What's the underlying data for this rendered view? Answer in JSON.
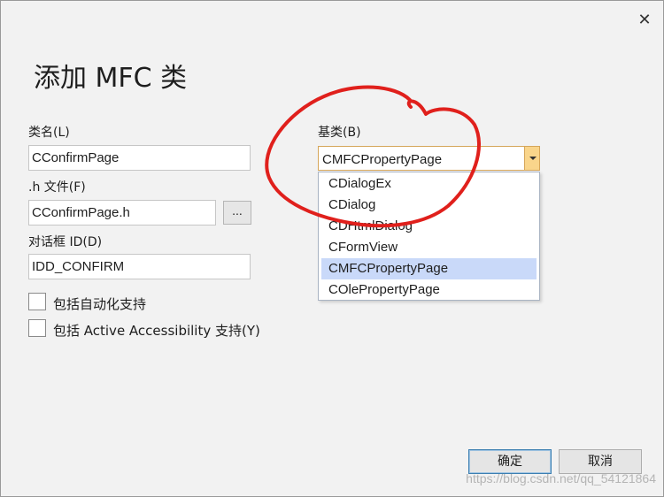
{
  "dialog": {
    "title": "添加 MFC 类",
    "close_glyph": "✕"
  },
  "form": {
    "class_name_label": "类名(L)",
    "class_name_value": "CConfirmPage",
    "h_file_label": ".h 文件(F)",
    "h_file_value": "CConfirmPage.h",
    "browse_label": "...",
    "dialog_id_label": "对话框 ID(D)",
    "dialog_id_value": "IDD_CONFIRM",
    "automation_label": "包括自动化支持",
    "accessibility_label": "包括 Active Accessibility 支持(Y)",
    "base_class_label": "基类(B)",
    "base_class_value": "CMFCPropertyPage"
  },
  "dropdown": {
    "items": [
      {
        "label": "CDialogEx"
      },
      {
        "label": "CDialog"
      },
      {
        "label": "CDHtmlDialog"
      },
      {
        "label": "CFormView"
      },
      {
        "label": "CMFCPropertyPage"
      },
      {
        "label": "COlePropertyPage"
      }
    ],
    "selected": "CMFCPropertyPage"
  },
  "buttons": {
    "ok": "确定",
    "cancel": "取消"
  },
  "watermark": "https://blog.csdn.net/qq_54121864",
  "colors": {
    "annotation": "#e0201c",
    "selection": "#c9d9f9",
    "combo_accent": "#f9d58b"
  }
}
